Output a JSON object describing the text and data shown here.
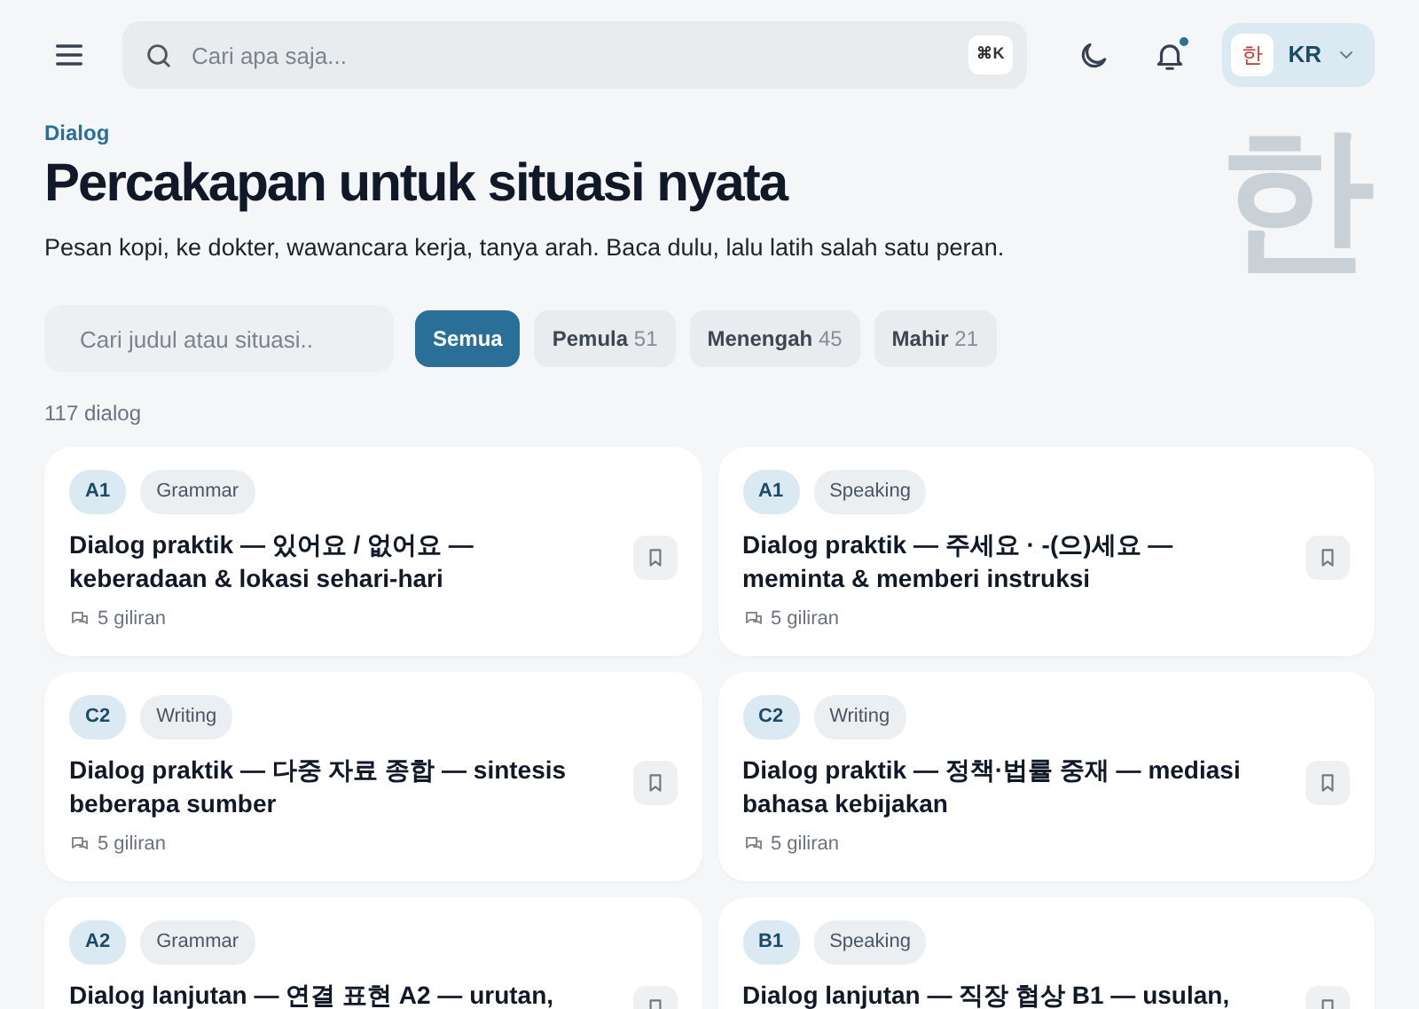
{
  "header": {
    "search": {
      "placeholder": "Cari apa saja...",
      "shortcut": "⌘K"
    },
    "notifications": {
      "unread": true
    },
    "language": {
      "glyph": "한",
      "code": "KR"
    }
  },
  "hero": {
    "eyebrow": "Dialog",
    "title": "Percakapan untuk situasi nyata",
    "subtitle": "Pesan kopi, ke dokter, wawancara kerja, tanya arah. Baca dulu, lalu latih salah satu peran.",
    "decor_glyph": "한"
  },
  "filter": {
    "search": {
      "placeholder": "Cari judul atau situasi.."
    },
    "tabs": [
      {
        "label": "Semua",
        "selected": true
      },
      {
        "label": "Pemula",
        "count": "51",
        "selected": false
      },
      {
        "label": "Menengah",
        "count": "45",
        "selected": false
      },
      {
        "label": "Mahir",
        "count": "21",
        "selected": false
      }
    ]
  },
  "result_count": "117 dialog",
  "dialogs": [
    {
      "level": "A1",
      "skill": "Grammar",
      "title": "Dialog praktik — 있어요 / 없어요 — keberadaan & lokasi sehari-hari",
      "turns": "5 giliran"
    },
    {
      "level": "A1",
      "skill": "Speaking",
      "title": "Dialog praktik — 주세요 · -(으)세요 — meminta & memberi instruksi",
      "turns": "5 giliran"
    },
    {
      "level": "C2",
      "skill": "Writing",
      "title": "Dialog praktik — 다중 자료 종합 — sintesis beberapa sumber",
      "turns": "5 giliran"
    },
    {
      "level": "C2",
      "skill": "Writing",
      "title": "Dialog praktik — 정책·법률 중재 — mediasi bahasa kebijakan",
      "turns": "5 giliran"
    },
    {
      "level": "A2",
      "skill": "Grammar",
      "title": "Dialog lanjutan — 연결 표현 A2 — urutan,"
    },
    {
      "level": "B1",
      "skill": "Speaking",
      "title": "Dialog lanjutan — 직장 협상 B1 — usulan,"
    }
  ]
}
